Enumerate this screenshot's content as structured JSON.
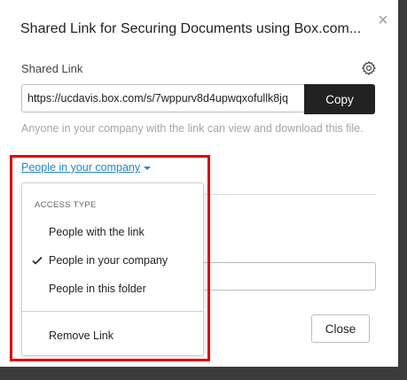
{
  "dialog": {
    "title": "Shared Link for Securing Documents using Box.com...",
    "close_glyph": "×",
    "shared_link_label": "Shared Link",
    "link_value": "https://ucdavis.box.com/s/7wppurv8d4upwqxofullk8jq",
    "copy_label": "Copy",
    "description": "Anyone in your company with the link can view and download this file.",
    "access_selector": "People in your company",
    "close_label": "Close"
  },
  "dropdown": {
    "header": "ACCESS TYPE",
    "items": [
      {
        "label": "People with the link",
        "checked": false
      },
      {
        "label": "People in your company",
        "checked": true
      },
      {
        "label": "People in this folder",
        "checked": false
      }
    ],
    "remove_label": "Remove Link"
  },
  "icons": {
    "close": "close-icon",
    "settings": "gear-icon",
    "selected": "checkmark-icon",
    "dropdown": "caret-down-icon"
  },
  "colors": {
    "link": "#2486c8",
    "copy_button": "#222222",
    "highlight": "#e00000"
  }
}
